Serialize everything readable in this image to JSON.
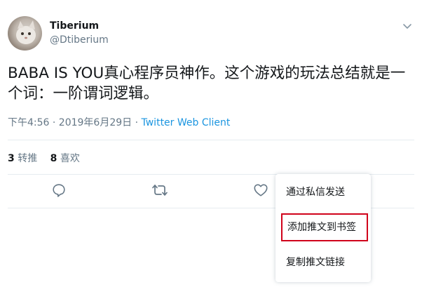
{
  "tweet": {
    "display_name": "Tiberium",
    "handle": "@Dtiberium",
    "text": "BABA IS YOU真心程序员神作。这个游戏的玩法总结就是一个词：一阶谓词逻辑。",
    "timestamp": "下午4:56 · 2019年6月29日 · ",
    "client": "Twitter Web Client",
    "stats": {
      "retweets_count": "3",
      "retweets_label": "转推",
      "likes_count": "8",
      "likes_label": "喜欢"
    }
  },
  "icons": {
    "reply": "reply-icon",
    "retweet": "retweet-icon",
    "like": "heart-icon",
    "caret": "chevron-down-icon"
  },
  "share_menu": {
    "items": [
      {
        "label": "通过私信发送"
      },
      {
        "label": "添加推文到书签",
        "highlighted": true
      },
      {
        "label": "复制推文链接"
      }
    ]
  },
  "colors": {
    "link": "#1b95e0",
    "muted": "#657786",
    "text": "#14171a",
    "highlight_border": "#d0021b"
  }
}
